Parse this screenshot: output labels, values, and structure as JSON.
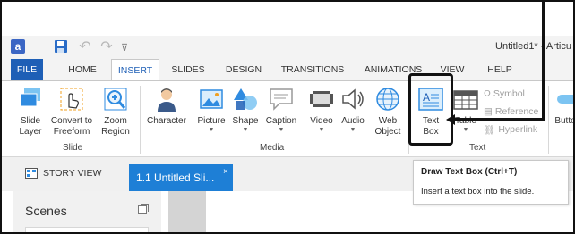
{
  "window": {
    "app_logo": "a",
    "doc_title": "Untitled1* - Articu"
  },
  "qat": {
    "undo": "↶",
    "redo": "↷",
    "menu": "⊽"
  },
  "tabs": [
    "FILE",
    "HOME",
    "INSERT",
    "SLIDES",
    "DESIGN",
    "TRANSITIONS",
    "ANIMATIONS",
    "VIEW",
    "HELP"
  ],
  "ribbon": {
    "slide_layer": [
      "Slide",
      "Layer"
    ],
    "convert_to_freeform": [
      "Convert to",
      "Freeform"
    ],
    "zoom_region": [
      "Zoom",
      "Region"
    ],
    "character": "Character",
    "picture": "Picture",
    "shape": "Shape",
    "caption": "Caption",
    "video": "Video",
    "audio": "Audio",
    "web_object": [
      "Web",
      "Object"
    ],
    "text_box": [
      "Text",
      "Box"
    ],
    "table": "Table",
    "symbol": "Symbol",
    "reference": "Reference",
    "hyperlink": "Hyperlink",
    "button": "Butto",
    "group_slide": "Slide",
    "group_media": "Media",
    "group_text": "Text"
  },
  "views": {
    "story_view": "STORY VIEW",
    "slide_tab": "1.1 Untitled Sli...",
    "close": "×"
  },
  "scenes": {
    "title": "Scenes"
  },
  "tooltip": {
    "title": "Draw Text Box (Ctrl+T)",
    "body": "Insert a text box into the slide."
  },
  "colors": {
    "accent": "#1e5fb6",
    "tab_active": "#1e7fd6"
  }
}
